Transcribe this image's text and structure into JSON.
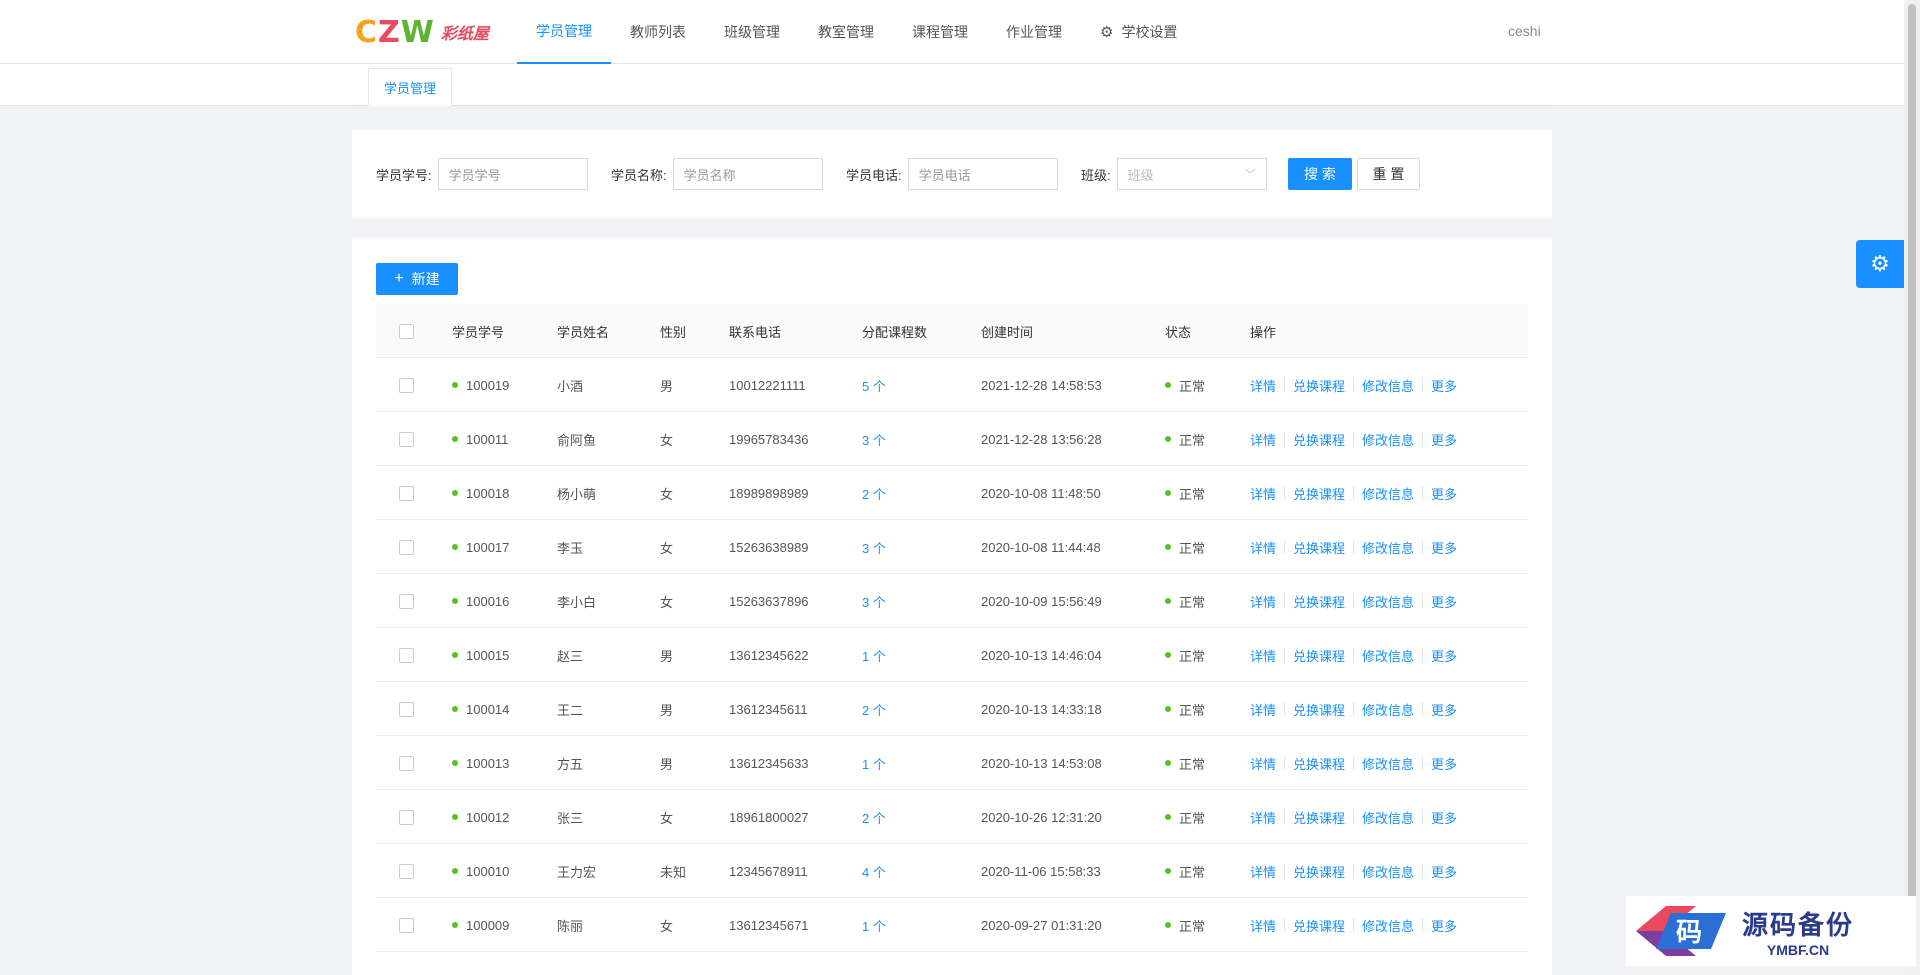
{
  "logo": {
    "letters": [
      "C",
      "Z",
      "W"
    ],
    "name": "彩纸屋"
  },
  "nav": {
    "items": [
      {
        "label": "学员管理",
        "active": true
      },
      {
        "label": "教师列表"
      },
      {
        "label": "班级管理"
      },
      {
        "label": "教室管理"
      },
      {
        "label": "课程管理"
      },
      {
        "label": "作业管理"
      },
      {
        "label": "学校设置",
        "icon": "gear-icon"
      }
    ],
    "user": "ceshi"
  },
  "tabs": [
    {
      "label": "学员管理"
    }
  ],
  "search": {
    "student_no": {
      "label": "学员学号:",
      "placeholder": "学员学号"
    },
    "student_name": {
      "label": "学员名称:",
      "placeholder": "学员名称"
    },
    "phone": {
      "label": "学员电话:",
      "placeholder": "学员电话"
    },
    "class": {
      "label": "班级:",
      "placeholder": "班级"
    },
    "search_label": "搜 索",
    "reset_label": "重 置"
  },
  "toolbar": {
    "new_label": "新建"
  },
  "table": {
    "columns": [
      "学员学号",
      "学员姓名",
      "性别",
      "联系电话",
      "分配课程数",
      "创建时间",
      "状态",
      "操作"
    ],
    "actions": [
      "详情",
      "兑换课程",
      "修改信息",
      "更多"
    ],
    "rows": [
      {
        "no": "100019",
        "name": "小酒",
        "gender": "男",
        "phone": "10012221111",
        "courses": "5 个",
        "created": "2021-12-28 14:58:53",
        "status": "正常"
      },
      {
        "no": "100011",
        "name": "俞阿鱼",
        "gender": "女",
        "phone": "19965783436",
        "courses": "3 个",
        "created": "2021-12-28 13:56:28",
        "status": "正常"
      },
      {
        "no": "100018",
        "name": "杨小萌",
        "gender": "女",
        "phone": "18989898989",
        "courses": "2 个",
        "created": "2020-10-08 11:48:50",
        "status": "正常"
      },
      {
        "no": "100017",
        "name": "李玉",
        "gender": "女",
        "phone": "15263638989",
        "courses": "3 个",
        "created": "2020-10-08 11:44:48",
        "status": "正常"
      },
      {
        "no": "100016",
        "name": "李小白",
        "gender": "女",
        "phone": "15263637896",
        "courses": "3 个",
        "created": "2020-10-09 15:56:49",
        "status": "正常"
      },
      {
        "no": "100015",
        "name": "赵三",
        "gender": "男",
        "phone": "13612345622",
        "courses": "1 个",
        "created": "2020-10-13 14:46:04",
        "status": "正常"
      },
      {
        "no": "100014",
        "name": "王二",
        "gender": "男",
        "phone": "13612345611",
        "courses": "2 个",
        "created": "2020-10-13 14:33:18",
        "status": "正常"
      },
      {
        "no": "100013",
        "name": "方五",
        "gender": "男",
        "phone": "13612345633",
        "courses": "1 个",
        "created": "2020-10-13 14:53:08",
        "status": "正常"
      },
      {
        "no": "100012",
        "name": "张三",
        "gender": "女",
        "phone": "18961800027",
        "courses": "2 个",
        "created": "2020-10-26 12:31:20",
        "status": "正常"
      },
      {
        "no": "100010",
        "name": "王力宏",
        "gender": "未知",
        "phone": "12345678911",
        "courses": "4 个",
        "created": "2020-11-06 15:58:33",
        "status": "正常"
      },
      {
        "no": "100009",
        "name": "陈丽",
        "gender": "女",
        "phone": "13612345671",
        "courses": "1 个",
        "created": "2020-09-27 01:31:20",
        "status": "正常"
      }
    ]
  },
  "watermark": {
    "mark": "码",
    "title": "源码备份",
    "domain": "YMBF.CN"
  },
  "colors": {
    "primary": "#1890ff",
    "status_ok": "#52c41a"
  }
}
